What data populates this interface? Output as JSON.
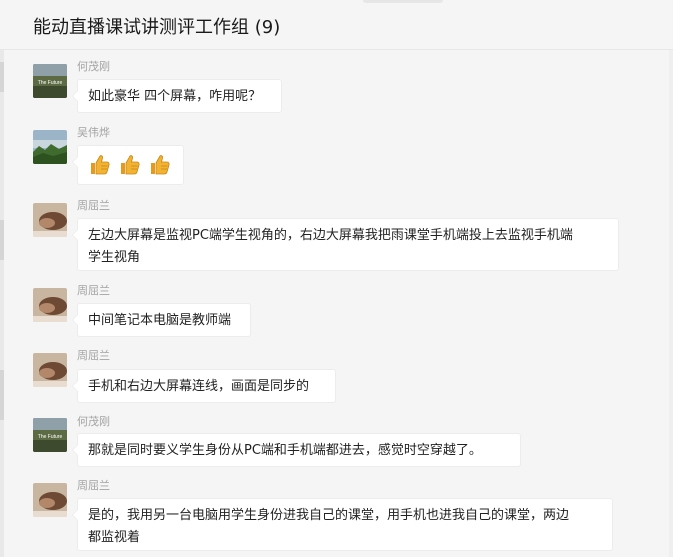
{
  "chat": {
    "title": "能动直播课试讲测评工作组 (9)"
  },
  "avatars": {
    "he_maogang": {
      "caption": "The Future"
    },
    "wu_weiye": {
      "type": "landscape"
    },
    "zhou_qulan": {
      "type": "hand-photo"
    }
  },
  "messages": [
    {
      "sender": "何茂刚",
      "text": "如此豪华 四个屏幕，咋用呢？"
    },
    {
      "sender": "吴伟烨",
      "emoji": [
        "thumbs-up-icon",
        "thumbs-up-icon",
        "thumbs-up-icon"
      ]
    },
    {
      "sender": "周屈兰",
      "lines": [
        "左边大屏幕是监视PC端学生视角的，右边大屏幕我把雨课堂手机端投上去监视手机端",
        "学生视角"
      ]
    },
    {
      "sender": "周屈兰",
      "text": "中间笔记本电脑是教师端"
    },
    {
      "sender": "周屈兰",
      "text": "手机和右边大屏幕连线，画面是同步的"
    },
    {
      "sender": "何茂刚",
      "text": "那就是同时要义学生身份从PC端和手机端都进去，感觉时空穿越了。"
    },
    {
      "sender": "周屈兰",
      "lines": [
        "是的，我用另一台电脑用学生身份进我自己的课堂，用手机也进我自己的课堂，两边",
        "都监视着"
      ]
    }
  ],
  "colors": {
    "background": "#f5f5f5",
    "bubble": "#ffffff",
    "sender_name": "#a3a3a3",
    "thumb": "#f2b233"
  }
}
